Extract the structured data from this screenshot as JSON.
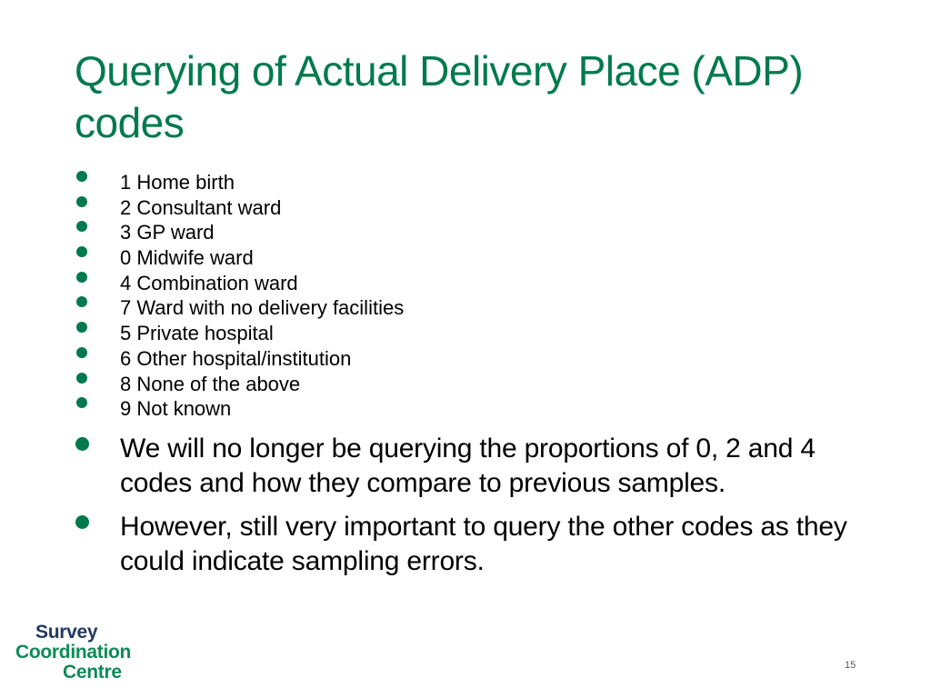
{
  "slide": {
    "title": "Querying of Actual Delivery Place (ADP) codes",
    "codes": [
      "1 Home birth",
      "2 Consultant ward",
      "3 GP ward",
      "0 Midwife ward",
      "4 Combination ward",
      "7 Ward with no delivery facilities",
      "5 Private hospital",
      "6 Other hospital/institution",
      "8 None of the above",
      "9 Not known"
    ],
    "notes": [
      "We will no longer be querying the proportions of 0, 2 and 4 codes and how they compare to previous samples.",
      "However, still very important to query the other codes as they could indicate sampling errors."
    ],
    "page_number": "15"
  },
  "logo": {
    "line1": "Survey",
    "line2": "Coordination",
    "line3": "Centre"
  },
  "colors": {
    "accent_green": "#007a4d",
    "logo_navy": "#1f3a5f",
    "logo_green": "#0e8a57"
  }
}
